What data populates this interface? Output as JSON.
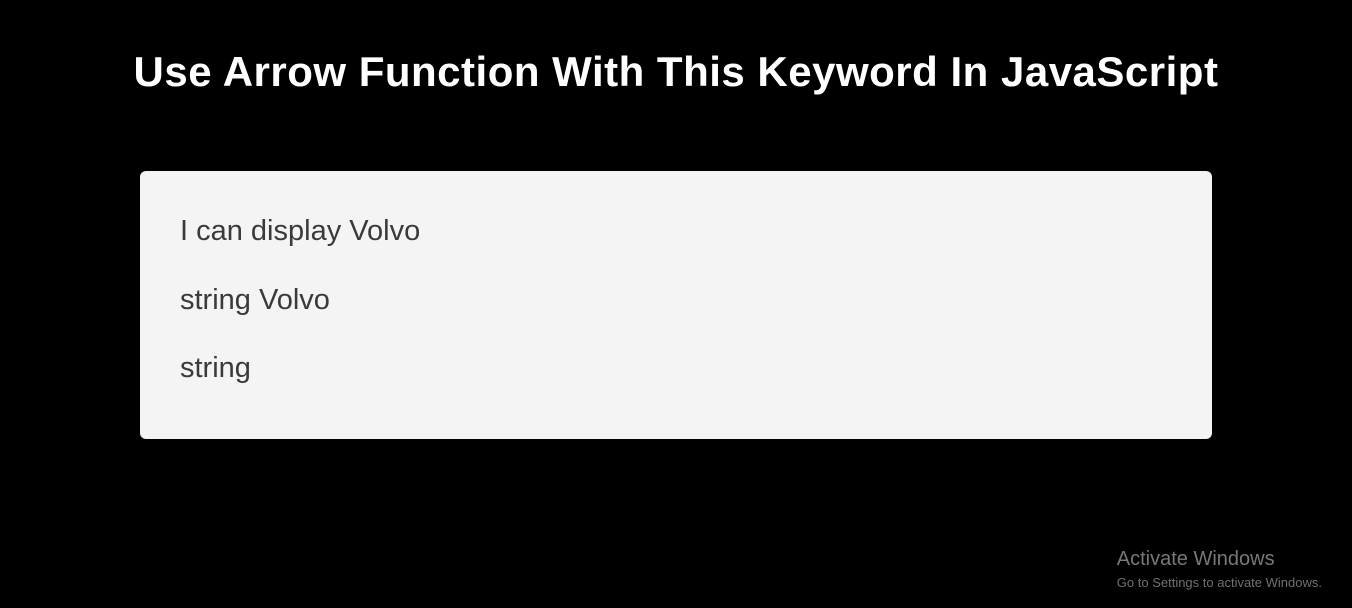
{
  "page": {
    "title": "Use Arrow Function With This Keyword In JavaScript"
  },
  "output": {
    "line1": "I can display Volvo",
    "line2": "string Volvo",
    "line3": "string"
  },
  "watermark": {
    "title": "Activate Windows",
    "subtitle": "Go to Settings to activate Windows."
  }
}
